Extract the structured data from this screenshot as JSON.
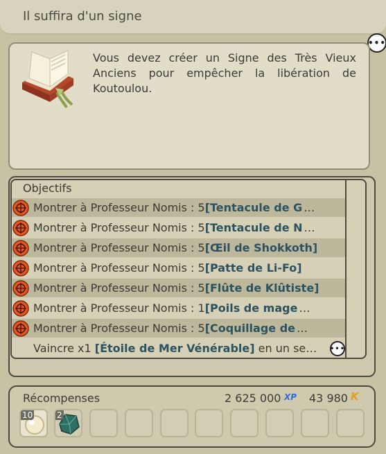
{
  "quest": {
    "title": "Il suffira d'un signe",
    "description": "Vous devez créer un Signe des Très Vieux Anciens pour empêcher la libération de Koutoulou."
  },
  "objectives": {
    "header": "Objectifs",
    "rows": [
      {
        "prefix": "Montrer à Professeur Nomis : 5 ",
        "item": "[Tentacule de G",
        "suffix": "…",
        "icon": "compass-icon"
      },
      {
        "prefix": "Montrer à Professeur Nomis : 5 ",
        "item": "[Tentacule de N",
        "suffix": "…",
        "icon": "compass-icon"
      },
      {
        "prefix": "Montrer à Professeur Nomis : 5 ",
        "item": "[Œil de Shokkoth]",
        "suffix": "",
        "icon": "compass-icon"
      },
      {
        "prefix": "Montrer à Professeur Nomis : 5 ",
        "item": "[Patte de Li-Fo]",
        "suffix": "",
        "icon": "compass-icon"
      },
      {
        "prefix": "Montrer à Professeur Nomis : 5 ",
        "item": "[Flûte de Klûtiste]",
        "suffix": "",
        "icon": "compass-icon"
      },
      {
        "prefix": "Montrer à Professeur Nomis : 1 ",
        "item": "[Poils de mage ",
        "suffix": "…",
        "icon": "compass-icon"
      },
      {
        "prefix": "Montrer à Professeur Nomis : 5 ",
        "item": "[Coquillage de ",
        "suffix": "…",
        "icon": "compass-icon"
      }
    ],
    "last": {
      "prefix": "Vaincre x1 ",
      "item": "[Étoile de Mer Vénérable]",
      "suffix": " en un se…"
    }
  },
  "rewards": {
    "label": "Récompenses",
    "xp": "2 625 000",
    "xp_badge": "XP",
    "kamas": "43 980",
    "kamas_badge": "K",
    "items": [
      {
        "count": "10",
        "icon": "pearl-icon"
      },
      {
        "count": "2",
        "icon": "green-stone-icon"
      }
    ]
  },
  "colors": {
    "item_link": "#2c5260",
    "xp": "#2a6fd6",
    "kamas": "#e0a020"
  }
}
